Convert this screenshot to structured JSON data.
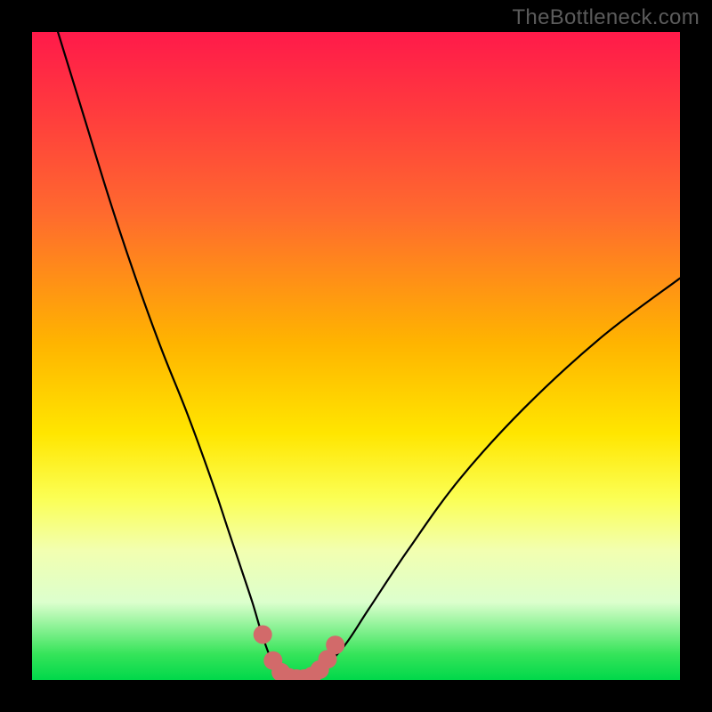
{
  "watermark": "TheBottleneck.com",
  "chart_data": {
    "type": "line",
    "title": "",
    "xlabel": "",
    "ylabel": "",
    "x_range": [
      0,
      100
    ],
    "y_range": [
      0,
      100
    ],
    "grid": false,
    "legend": false,
    "series": [
      {
        "name": "main-curve",
        "color": "#000000",
        "x": [
          4,
          8,
          12,
          16,
          20,
          24,
          28,
          30,
          32,
          34,
          35.5,
          37,
          38.5,
          40,
          42,
          44,
          48,
          52,
          58,
          66,
          76,
          88,
          100
        ],
        "values": [
          100,
          87,
          74,
          62,
          51,
          41,
          30,
          24,
          18,
          12,
          7,
          3,
          1,
          0,
          0,
          1,
          5,
          11,
          20,
          31,
          42,
          53,
          62
        ]
      },
      {
        "name": "highlight-dots",
        "color": "#d26a6a",
        "type": "scatter",
        "x": [
          35.6,
          37.2,
          38.4,
          39.6,
          40.8,
          42.0,
          43.2,
          44.4,
          45.6,
          46.8
        ],
        "values": [
          7.0,
          3.0,
          1.2,
          0.4,
          0.2,
          0.2,
          0.6,
          1.6,
          3.2,
          5.4
        ]
      }
    ],
    "annotations": []
  }
}
